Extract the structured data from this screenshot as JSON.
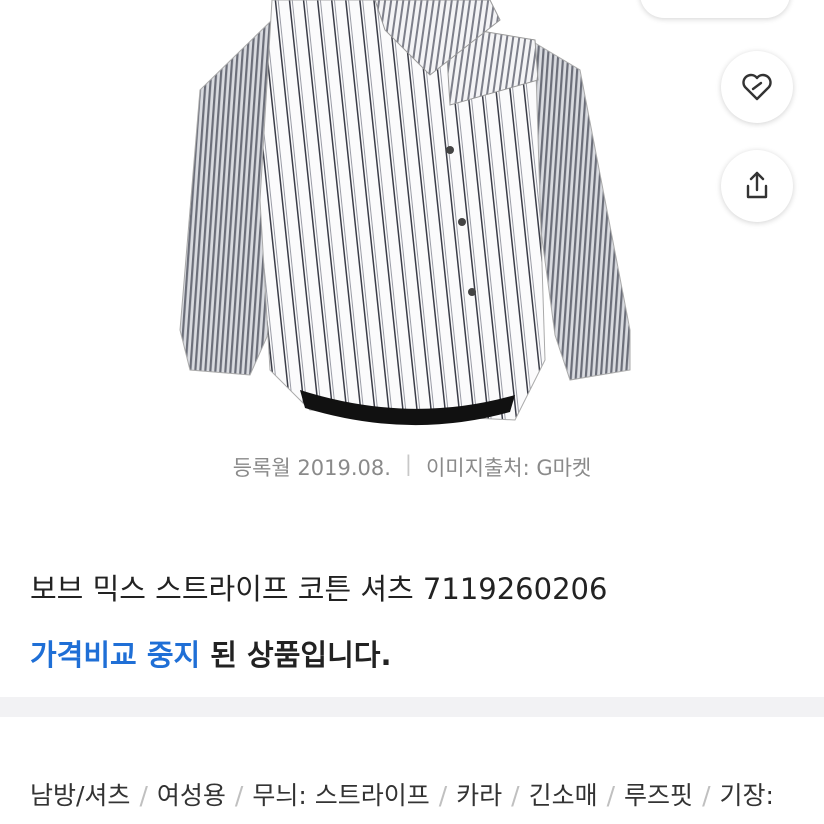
{
  "product": {
    "reg_date": "등록월 2019.08.",
    "separator": "|",
    "image_source": "이미지출처: G마켓",
    "title": "보브 믹스 스트라이프 코튼 셔츠 7119260206",
    "status_highlight": "가격비교 중지",
    "status_rest": " 된 상품입니다."
  },
  "actions": {
    "like_icon": "heart-icon",
    "share_icon": "share-icon"
  },
  "attributes": {
    "items": [
      "남방/셔츠",
      "여성용",
      "무늬: 스트라이프",
      "카라",
      "긴소매",
      "루즈핏",
      "기장:"
    ],
    "divider": "/"
  },
  "colors": {
    "accent": "#1f6fd6",
    "muted": "#8a8a8a",
    "section_bg": "#f2f2f4"
  }
}
